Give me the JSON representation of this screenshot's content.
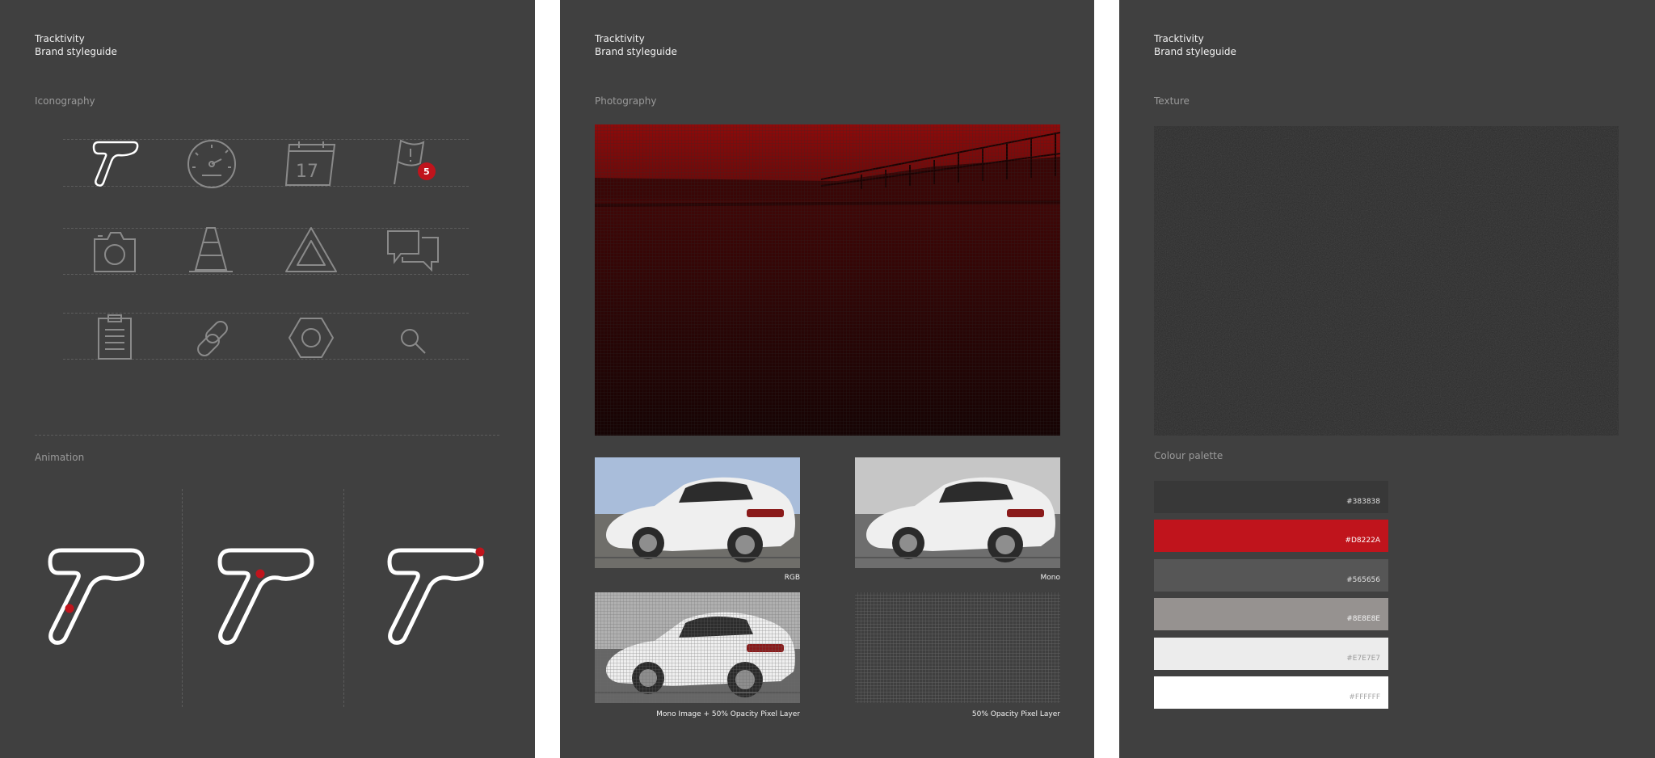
{
  "brand": {
    "name": "Tracktivity",
    "subtitle": "Brand styleguide"
  },
  "iconography": {
    "title": "Iconography",
    "icons": [
      "tracktivity-logo-icon",
      "speedometer-icon",
      "calendar-icon",
      "flag-notification-icon",
      "camera-icon",
      "traffic-cone-icon",
      "warning-triangle-icon",
      "chat-bubbles-icon",
      "clipboard-icon",
      "link-icon",
      "hex-nut-icon",
      "search-icon"
    ],
    "calendar_day": "17",
    "notification_count": "5"
  },
  "animation": {
    "title": "Animation"
  },
  "photography": {
    "title": "Photography",
    "captions": [
      "RGB",
      "Mono",
      "Mono Image + 50% Opacity Pixel Layer",
      "50% Opacity Pixel Layer"
    ]
  },
  "texture": {
    "title": "Texture"
  },
  "palette": {
    "title": "Colour palette",
    "colors": [
      {
        "label": "#383838",
        "hex": "#383838",
        "text": "#e0e0e0"
      },
      {
        "label": "#D8222A",
        "hex": "#c0141c",
        "text": "#ffffff"
      },
      {
        "label": "#565656",
        "hex": "#565656",
        "text": "#e0e0e0"
      },
      {
        "label": "#8E8E8E",
        "hex": "#969290",
        "text": "#f2f2f2"
      },
      {
        "label": "#E7E7E7",
        "hex": "#ececec",
        "text": "#9a9a9a"
      },
      {
        "label": "#FFFFFF",
        "hex": "#ffffff",
        "text": "#a8a8a8"
      }
    ]
  },
  "colors": {
    "panel": "#404040",
    "accent": "#c0141c",
    "icon": "#8a8a8a"
  }
}
